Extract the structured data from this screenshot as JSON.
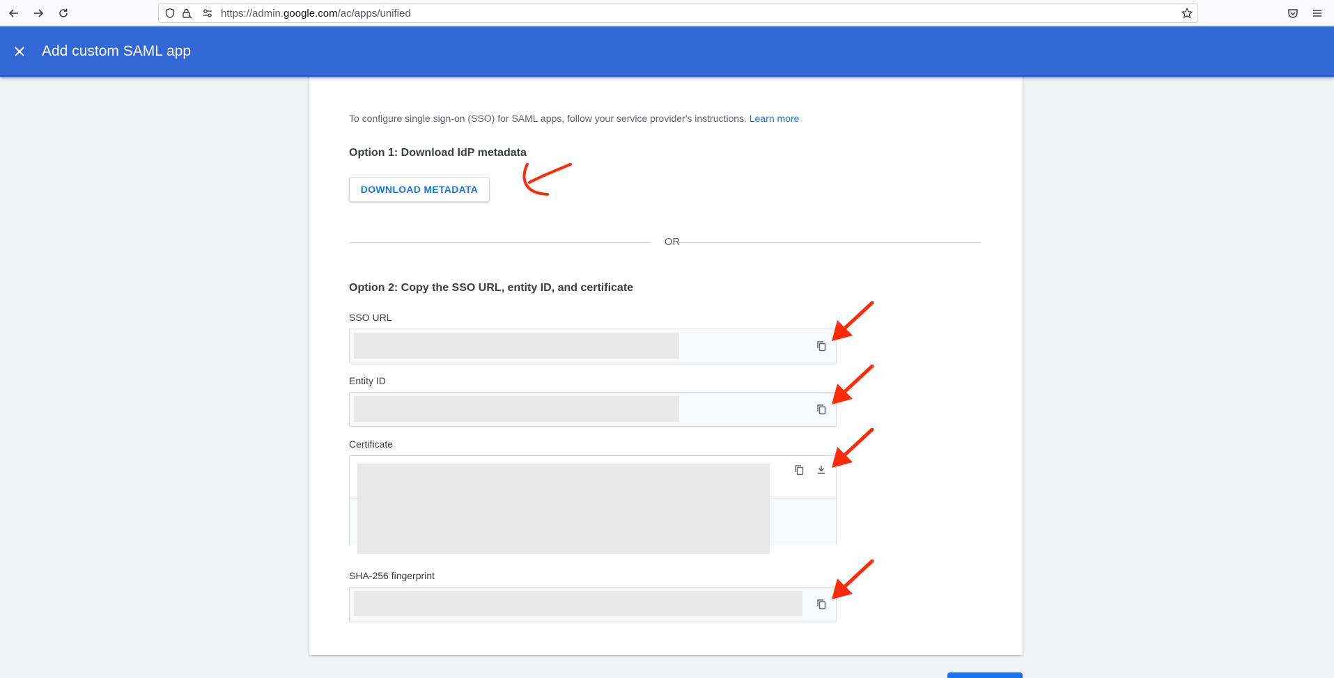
{
  "browser": {
    "url_prefix": "https://admin.",
    "url_host": "google.com",
    "url_path": "/ac/apps/unified"
  },
  "header": {
    "title": "Add custom SAML app",
    "color": "#3367d6"
  },
  "main": {
    "intro_text": "To configure single sign-on (SSO) for SAML apps, follow your service provider's instructions.",
    "learn_more": "Learn more",
    "option1_title": "Option 1: Download IdP metadata",
    "download_button": "DOWNLOAD METADATA",
    "or_text": "OR",
    "option2_title": "Option 2: Copy the SSO URL, entity ID, and certificate",
    "fields": {
      "sso_url_label": "SSO URL",
      "entity_id_label": "Entity ID",
      "certificate_label": "Certificate",
      "fingerprint_label": "SHA-256 fingerprint"
    }
  },
  "colors": {
    "accent": "#1a73e8",
    "annotation": "#ff2a0a"
  },
  "icons": [
    "back-arrow-icon",
    "forward-arrow-icon",
    "reload-icon",
    "shield-icon",
    "lock-icon",
    "permissions-icon",
    "star-icon",
    "pocket-icon",
    "menu-icon",
    "close-icon",
    "copy-icon",
    "download-icon"
  ]
}
